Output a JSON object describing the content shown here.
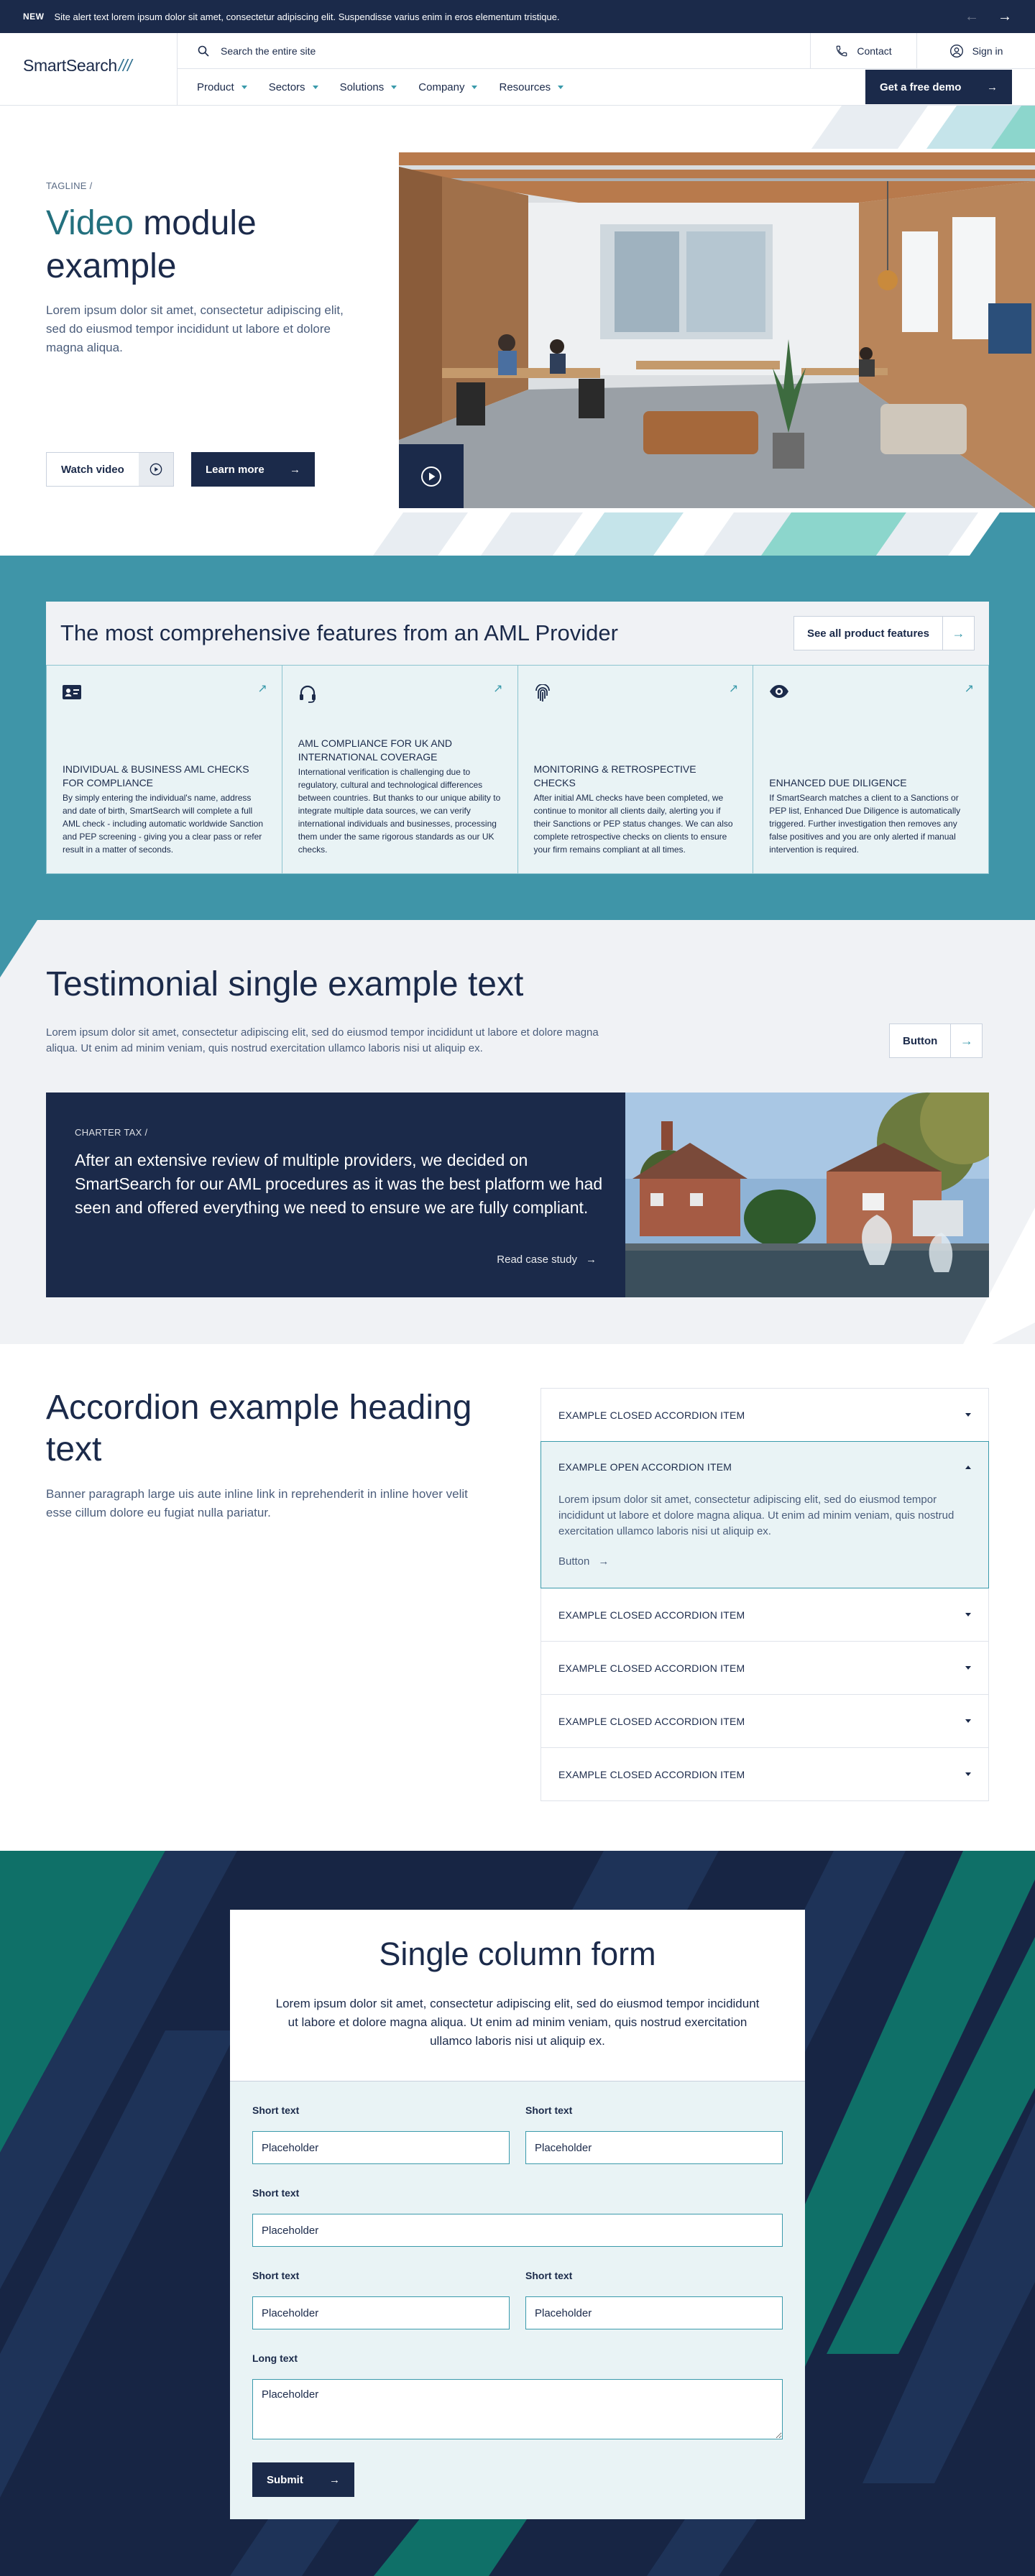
{
  "alert": {
    "badge": "NEW",
    "message": "Site alert text lorem ipsum dolor sit amet, consectetur adipiscing elit. Suspendisse varius enim in eros elementum tristique."
  },
  "header": {
    "logo": "SmartSearch",
    "logo_mark": "///",
    "search_placeholder": "Search the entire site",
    "contact": "Contact",
    "signin": "Sign in",
    "nav": [
      "Product",
      "Sectors",
      "Solutions",
      "Company",
      "Resources"
    ],
    "demo_button": "Get a free demo"
  },
  "hero": {
    "tagline": "TAGLINE /",
    "title_accent": "Video",
    "title_rest": " module example",
    "description": "Lorem ipsum dolor sit amet, consectetur adipiscing elit, sed do eiusmod tempor incididunt ut labore et dolore magna aliqua.",
    "watch_video": "Watch video",
    "learn_more": "Learn more"
  },
  "features": {
    "heading": "The most comprehensive features from an AML Provider",
    "button": "See all product features",
    "cards": [
      {
        "icon": "id-card-icon",
        "title": "INDIVIDUAL & BUSINESS AML CHECKS FOR COMPLIANCE",
        "text": "By simply entering the individual's name, address and date of birth, SmartSearch will complete a full AML check - including automatic worldwide Sanction and PEP screening - giving you a clear pass or refer result in a matter of seconds."
      },
      {
        "icon": "headset-icon",
        "title": "AML COMPLIANCE FOR UK AND INTERNATIONAL COVERAGE",
        "text": "International verification is challenging due to regulatory, cultural and technological differences between countries. But thanks to our unique ability to integrate multiple data sources, we can verify international individuals and businesses, processing them under the same rigorous standards as our UK checks."
      },
      {
        "icon": "fingerprint-icon",
        "title": "MONITORING & RETROSPECTIVE CHECKS",
        "text": "After initial AML checks have been completed, we continue to monitor all clients daily, alerting you if their Sanctions or PEP status changes. We can also complete retrospective checks on clients to ensure your firm remains compliant at all times."
      },
      {
        "icon": "eye-icon",
        "title": "ENHANCED DUE DILIGENCE",
        "text": "If SmartSearch matches a client to a Sanctions or PEP list, Enhanced Due Diligence is automatically triggered. Further investigation then removes any false positives and you are only alerted if manual intervention is required."
      }
    ]
  },
  "testimonial": {
    "heading": "Testimonial single example text",
    "description": "Lorem ipsum dolor sit amet, consectetur adipiscing elit, sed do eiusmod tempor incididunt ut labore et dolore magna aliqua. Ut enim ad minim veniam, quis nostrud exercitation ullamco laboris nisi ut aliquip ex.",
    "button": "Button",
    "tag": "CHARTER TAX /",
    "quote": "After an extensive review of multiple providers, we decided on SmartSearch for our AML procedures as it was the best platform we had seen and offered everything we need to ensure we are fully compliant.",
    "read_link": "Read case study"
  },
  "accordion": {
    "heading": "Accordion example heading text",
    "description": "Banner paragraph large uis aute inline link in reprehenderit in inline hover velit esse cillum dolore eu fugiat nulla pariatur.",
    "items": [
      {
        "label": "EXAMPLE CLOSED ACCORDION ITEM"
      },
      {
        "label": "EXAMPLE OPEN ACCORDION ITEM",
        "body": "Lorem ipsum dolor sit amet, consectetur adipiscing elit, sed do eiusmod tempor incididunt ut labore et dolore magna aliqua. Ut enim ad minim veniam, quis nostrud exercitation ullamco laboris nisi ut aliquip ex.",
        "button": "Button"
      },
      {
        "label": "EXAMPLE CLOSED ACCORDION ITEM"
      },
      {
        "label": "EXAMPLE CLOSED ACCORDION ITEM"
      },
      {
        "label": "EXAMPLE CLOSED ACCORDION ITEM"
      },
      {
        "label": "EXAMPLE CLOSED ACCORDION ITEM"
      }
    ]
  },
  "form": {
    "heading": "Single column form",
    "description": "Lorem ipsum dolor sit amet, consectetur adipiscing elit, sed do eiusmod tempor incididunt ut labore et dolore magna aliqua. Ut enim ad minim veniam, quis nostrud exercitation ullamco laboris nisi ut aliquip ex.",
    "short_label": "Short text",
    "long_label": "Long text",
    "placeholder": "Placeholder",
    "submit": "Submit"
  },
  "colors": {
    "navy": "#1b2a4a",
    "teal": "#3f95a8",
    "teal_accent": "#23707e",
    "light_teal": "#e9f3f5",
    "light_gray": "#f0f2f5"
  }
}
